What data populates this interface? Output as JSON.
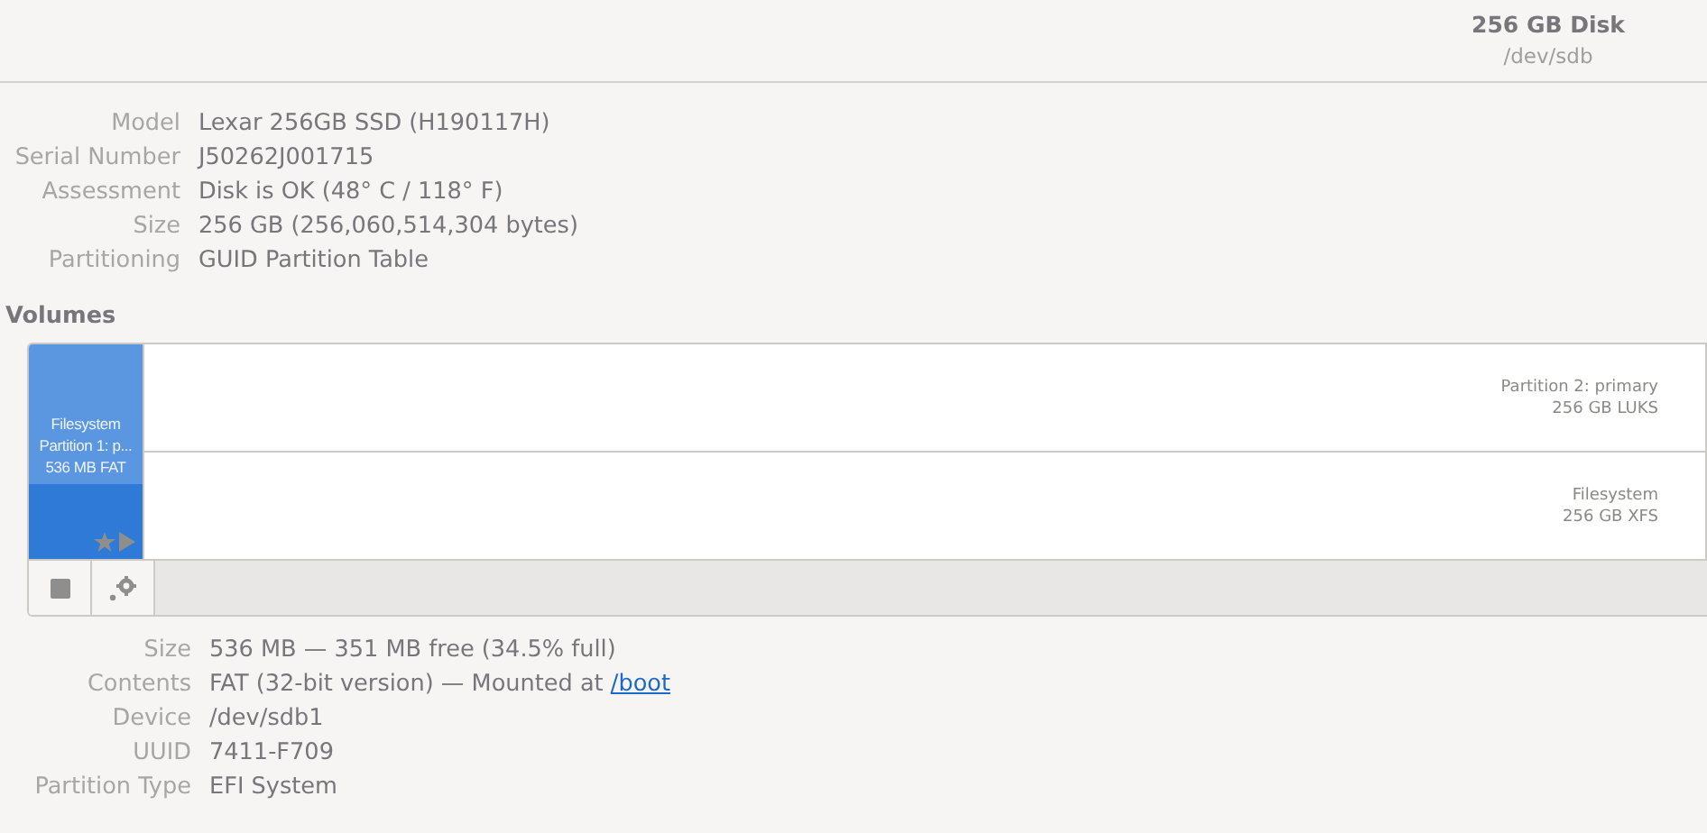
{
  "header": {
    "title": "256 GB Disk",
    "subtitle": "/dev/sdb"
  },
  "disk_info": [
    {
      "label": "Model",
      "value": "Lexar 256GB SSD (H190117H)"
    },
    {
      "label": "Serial Number",
      "value": "J50262J001715"
    },
    {
      "label": "Assessment",
      "value": "Disk is OK (48° C / 118° F)"
    },
    {
      "label": "Size",
      "value": "256 GB (256,060,514,304 bytes)"
    },
    {
      "label": "Partitioning",
      "value": "GUID Partition Table"
    }
  ],
  "volumes_heading": "Volumes",
  "volumes": [
    {
      "selected": true,
      "partition": [
        "Partition 1: p..."
      ],
      "filesystem": [
        "Filesystem",
        "536 MB FAT"
      ],
      "mounted": true
    },
    {
      "selected": false,
      "partition": [
        "Partition 2: primary",
        "256 GB LUKS"
      ],
      "filesystem": [
        "Filesystem",
        "256 GB XFS"
      ],
      "mounted": false
    }
  ],
  "volume_info": [
    {
      "label": "Size",
      "value": "536 MB — 351 MB free (34.5% full)"
    },
    {
      "label": "Contents",
      "value": "FAT (32-bit version) — Mounted at ",
      "link": "/boot"
    },
    {
      "label": "Device",
      "value": "/dev/sdb1"
    },
    {
      "label": "UUID",
      "value": "7411-F709"
    },
    {
      "label": "Partition Type",
      "value": "EFI System"
    }
  ]
}
